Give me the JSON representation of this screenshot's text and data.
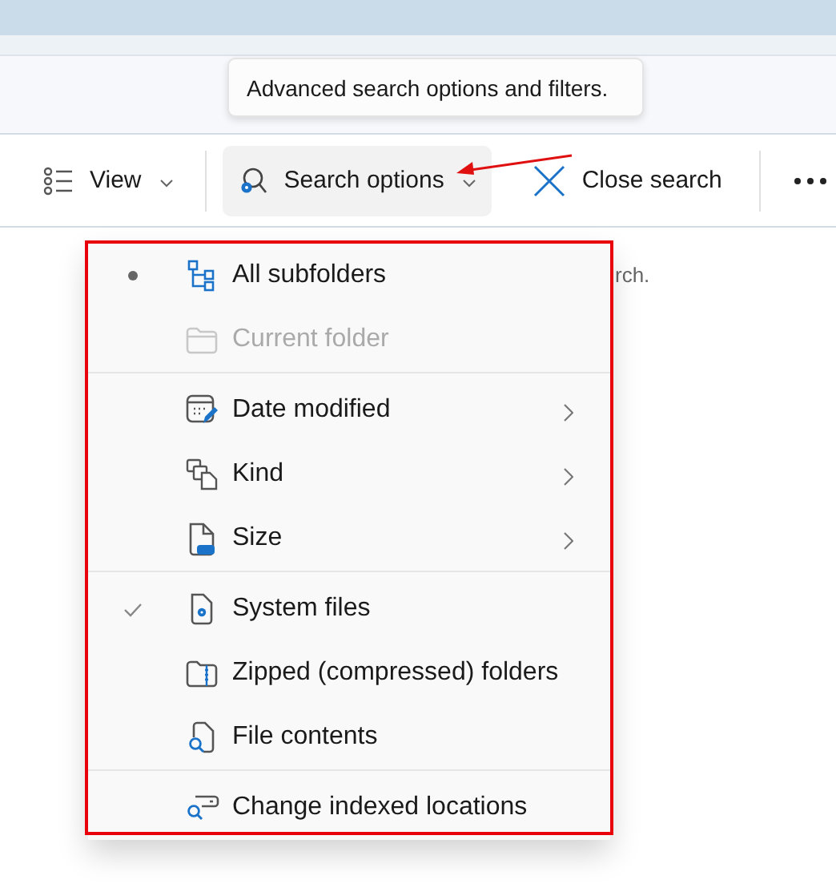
{
  "tooltip": {
    "text": "Advanced search options and filters."
  },
  "toolbar": {
    "items": [
      {
        "label": "View",
        "kind": "dropdown",
        "expanded": false
      },
      {
        "label": "Search options",
        "kind": "dropdown",
        "expanded": true
      },
      {
        "label": "Close search",
        "kind": "close"
      },
      {
        "kind": "more"
      }
    ]
  },
  "content": {
    "hint_text": "rch."
  },
  "menu": {
    "groups": [
      {
        "items": [
          {
            "label": "All subfolders",
            "kind": "radio",
            "selected": true,
            "disabled": false
          },
          {
            "label": "Current folder",
            "kind": "radio",
            "selected": false,
            "disabled": true
          }
        ]
      },
      {
        "items": [
          {
            "label": "Date modified",
            "kind": "submenu"
          },
          {
            "label": "Kind",
            "kind": "submenu"
          },
          {
            "label": "Size",
            "kind": "submenu"
          }
        ]
      },
      {
        "items": [
          {
            "label": "System files",
            "kind": "check",
            "checked": true
          },
          {
            "label": "Zipped (compressed) folders",
            "kind": "check",
            "checked": false
          },
          {
            "label": "File contents",
            "kind": "check",
            "checked": false
          }
        ]
      },
      {
        "items": [
          {
            "label": "Change indexed locations",
            "kind": "action"
          }
        ]
      }
    ]
  }
}
